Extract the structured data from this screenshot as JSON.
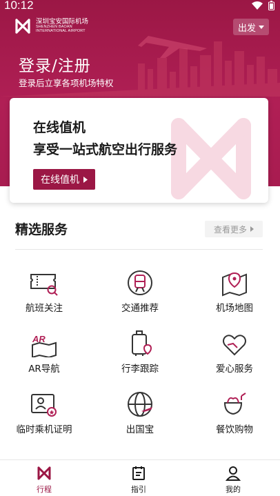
{
  "status": {
    "time": "10:12"
  },
  "header": {
    "logo_cn": "深圳宝安国际机场",
    "logo_en_1": "SHENZHEN BAOAN",
    "logo_en_2": "INTERNATIONAL AIRPORT",
    "mode": "出发"
  },
  "login": {
    "title": "登录/注册",
    "subtitle": "登录后立享各项机场特权"
  },
  "checkin_card": {
    "line1": "在线值机",
    "line2": "享受一站式航空出行服务",
    "button": "在线值机"
  },
  "services": {
    "title": "精选服务",
    "more": "查看更多",
    "items": [
      {
        "label": "航班关注",
        "icon": "ticket-search-icon"
      },
      {
        "label": "交通推荐",
        "icon": "train-icon"
      },
      {
        "label": "机场地图",
        "icon": "map-pin-icon"
      },
      {
        "label": "AR导航",
        "icon": "ar-map-icon"
      },
      {
        "label": "行李跟踪",
        "icon": "luggage-icon"
      },
      {
        "label": "爱心服务",
        "icon": "heart-hand-icon"
      },
      {
        "label": "临时乘机证明",
        "icon": "id-card-icon"
      },
      {
        "label": "出国宝",
        "icon": "globe-plane-icon"
      },
      {
        "label": "餐饮购物",
        "icon": "food-drink-icon"
      }
    ]
  },
  "tabbar": {
    "items": [
      {
        "label": "行程",
        "icon": "airport-logo-icon",
        "active": true
      },
      {
        "label": "指引",
        "icon": "guide-icon",
        "active": false
      },
      {
        "label": "我的",
        "icon": "profile-icon",
        "active": false
      }
    ]
  },
  "colors": {
    "brand": "#9b1745",
    "active_tab": "#9b1745"
  }
}
